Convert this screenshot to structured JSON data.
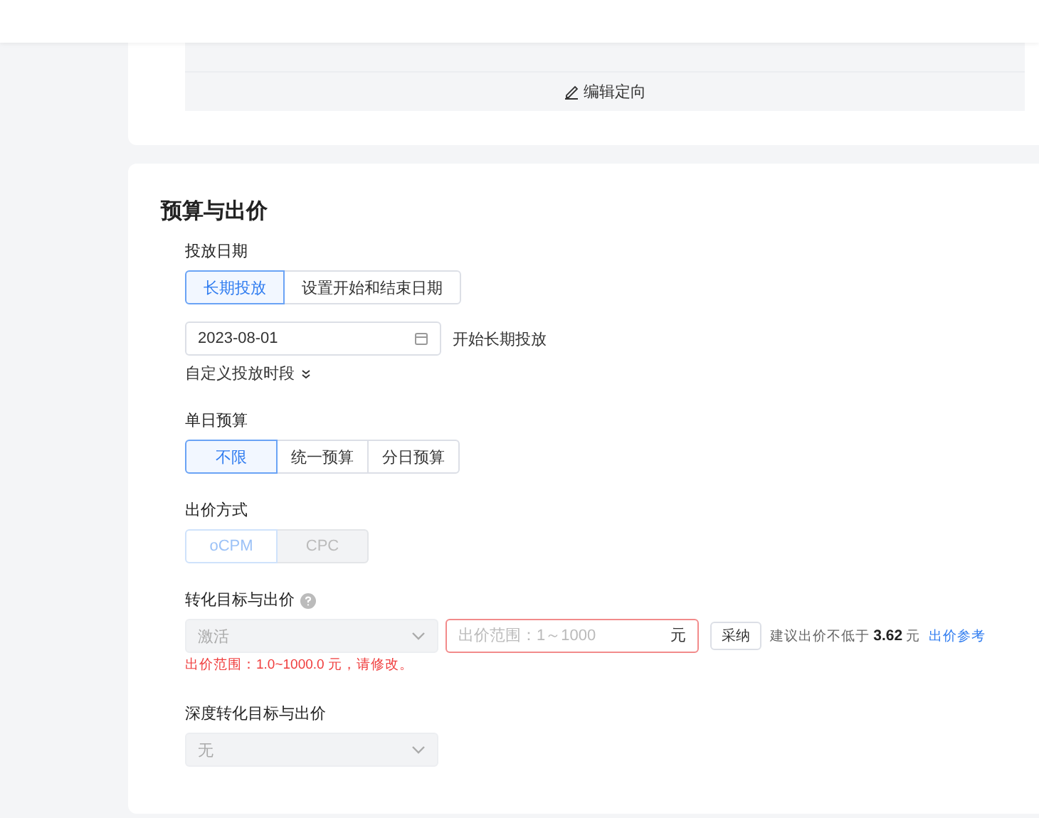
{
  "targeting": {
    "edit_button": "编辑定向"
  },
  "section": {
    "title": "预算与出价",
    "schedule": {
      "label": "投放日期",
      "options": [
        {
          "label": "长期投放",
          "selected": true
        },
        {
          "label": "设置开始和结束日期",
          "selected": false
        }
      ],
      "date": "2023-08-01",
      "date_note": "开始长期投放",
      "custom_toggle": "自定义投放时段"
    },
    "budget": {
      "label": "单日预算",
      "options": [
        {
          "label": "不限",
          "selected": true
        },
        {
          "label": "统一预算",
          "selected": false
        },
        {
          "label": "分日预算",
          "selected": false
        }
      ]
    },
    "bid_mode": {
      "label": "出价方式",
      "disabled": true,
      "options": [
        {
          "label": "oCPM",
          "selected": true
        },
        {
          "label": "CPC",
          "selected": false
        }
      ]
    },
    "conversion": {
      "label": "转化目标与出价",
      "goal": {
        "value": "激活",
        "disabled": true
      },
      "bid": {
        "placeholder": "出价范围：1～1000",
        "unit": "元",
        "error": true
      },
      "adopt_button": "采纳",
      "suggestion": "建议出价不低于 **3.62** 元",
      "reference_link": "出价参考",
      "error_message": "出价范围：1.0~1000.0 元，请修改。"
    },
    "deep_conversion": {
      "label": "深度转化目标与出价",
      "value": "无",
      "disabled": true
    }
  }
}
